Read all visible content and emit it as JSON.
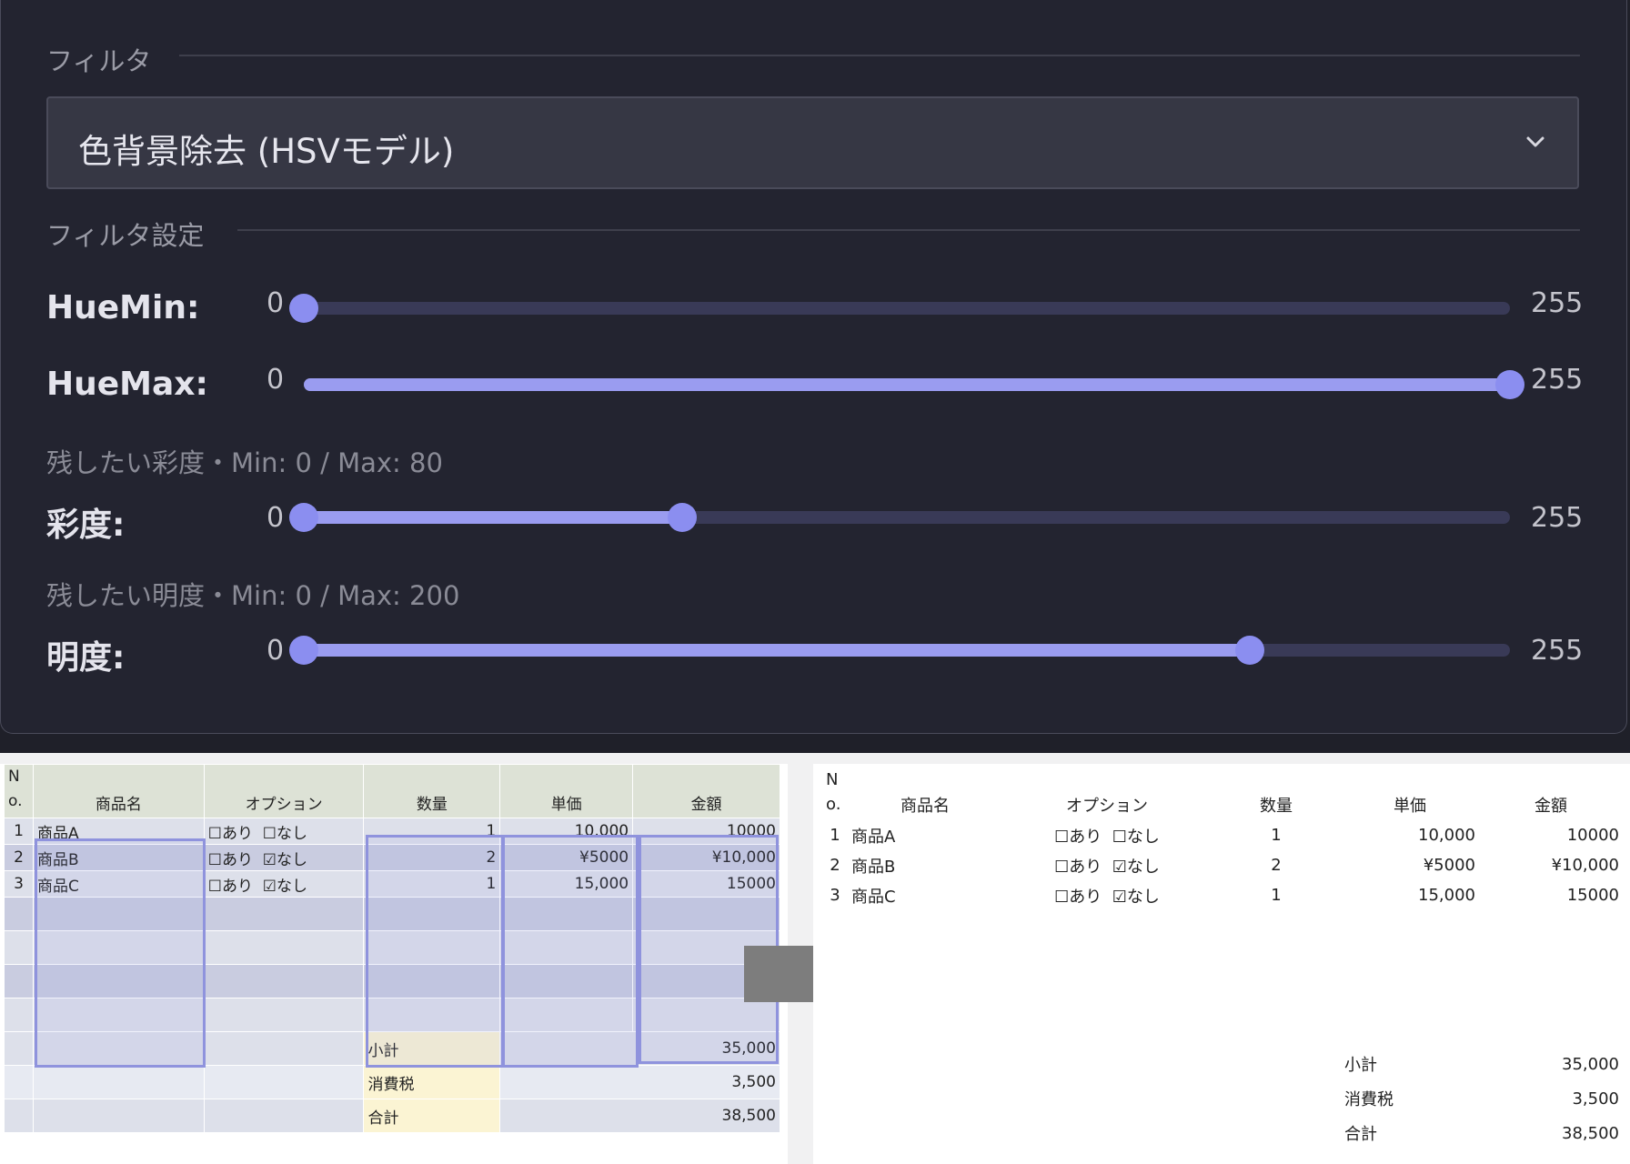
{
  "filter": {
    "section_label": "フィルタ",
    "selected": "色背景除去 (HSVモデル)"
  },
  "settings": {
    "section_label": "フィルタ設定",
    "sliders": [
      {
        "label": "HueMin:",
        "min": 0,
        "max": 255,
        "low": 0,
        "high": 0
      },
      {
        "label": "HueMax:",
        "min": 0,
        "max": 255,
        "low": 0,
        "high": 255
      },
      {
        "label": "彩度:",
        "min": 0,
        "max": 255,
        "low": 0,
        "high": 80
      },
      {
        "label": "明度:",
        "min": 0,
        "max": 255,
        "low": 0,
        "high": 200
      }
    ],
    "hint_saturation": "残したい彩度・Min: 0 / Max: 80",
    "hint_value": "残したい明度・Min: 0 / Max: 200"
  },
  "colors": {
    "panel_bg": "#232430",
    "accent": "#9a9cf0",
    "track": "#393a57"
  },
  "table": {
    "headers": [
      "N\no.",
      "商品名",
      "オプション",
      "数量",
      "単価",
      "金額"
    ],
    "rows": [
      {
        "no": "1",
        "name": "商品A",
        "opt_yes": "☐あり",
        "opt_no": "☐なし",
        "qty": "1",
        "price": "10,000",
        "amount": "10000"
      },
      {
        "no": "2",
        "name": "商品B",
        "opt_yes": "☐あり",
        "opt_no": "☑なし",
        "qty": "2",
        "price": "¥5000",
        "amount": "¥10,000"
      },
      {
        "no": "3",
        "name": "商品C",
        "opt_yes": "☐あり",
        "opt_no": "☑なし",
        "qty": "1",
        "price": "15,000",
        "amount": "15000"
      }
    ],
    "totals": [
      {
        "label": "小計",
        "value": "35,000"
      },
      {
        "label": "消費税",
        "value": "3,500"
      },
      {
        "label": "合計",
        "value": "38,500"
      }
    ]
  }
}
